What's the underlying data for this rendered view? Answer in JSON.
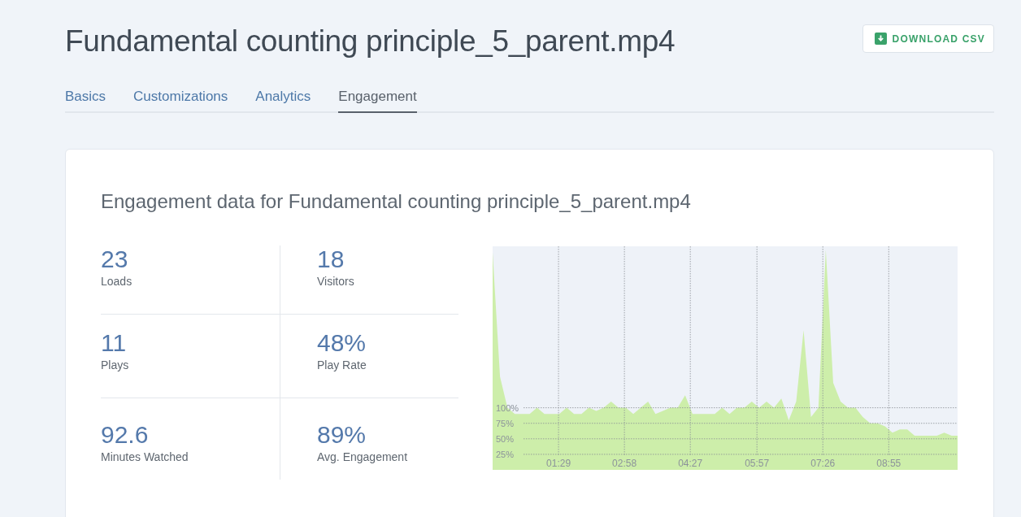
{
  "page": {
    "title": "Fundamental counting principle_5_parent.mp4"
  },
  "download_button": {
    "label": "DOWNLOAD CSV"
  },
  "tabs": [
    {
      "label": "Basics",
      "selected": false
    },
    {
      "label": "Customizations",
      "selected": false
    },
    {
      "label": "Analytics",
      "selected": false
    },
    {
      "label": "Engagement",
      "selected": true
    }
  ],
  "card": {
    "title": "Engagement data for Fundamental counting principle_5_parent.mp4",
    "stats": [
      {
        "value": "23",
        "label": "Loads"
      },
      {
        "value": "18",
        "label": "Visitors"
      },
      {
        "value": "11",
        "label": "Plays"
      },
      {
        "value": "48%",
        "label": "Play Rate"
      },
      {
        "value": "92.6",
        "label": "Minutes Watched"
      },
      {
        "value": "89%",
        "label": "Avg. Engagement"
      }
    ],
    "chart_data": {
      "type": "area",
      "x": [
        0,
        10,
        20,
        30,
        40,
        50,
        60,
        70,
        80,
        90,
        100,
        110,
        120,
        130,
        140,
        150,
        160,
        170,
        180,
        190,
        200,
        210,
        220,
        230,
        240,
        250,
        260,
        270,
        280,
        290,
        300,
        310,
        320,
        330,
        340,
        350,
        360,
        370,
        380,
        390,
        400,
        410,
        420,
        430,
        440,
        450,
        460,
        470,
        480,
        490,
        500,
        510,
        520,
        530,
        540,
        550,
        560,
        570,
        580,
        590,
        600,
        610,
        620,
        628
      ],
      "grid": true,
      "series": [
        {
          "color": "#cdeeaa",
          "values": [
            350,
            150,
            100,
            90,
            90,
            90,
            100,
            90,
            90,
            90,
            100,
            90,
            90,
            100,
            95,
            100,
            110,
            100,
            100,
            90,
            100,
            110,
            90,
            95,
            100,
            100,
            120,
            90,
            90,
            90,
            90,
            100,
            90,
            100,
            100,
            110,
            100,
            110,
            100,
            115,
            80,
            110,
            225,
            85,
            100,
            354,
            140,
            110,
            100,
            100,
            85,
            75,
            75,
            70,
            60,
            65,
            65,
            55,
            55,
            55,
            55,
            60,
            55,
            55
          ]
        }
      ],
      "xlim": [
        0,
        628
      ],
      "ylim": [
        0,
        360
      ],
      "xticks": [
        {
          "value": 89,
          "label": "01:29"
        },
        {
          "value": 178,
          "label": "02:58"
        },
        {
          "value": 267,
          "label": "04:27"
        },
        {
          "value": 357,
          "label": "05:57"
        },
        {
          "value": 446,
          "label": "07:26"
        },
        {
          "value": 535,
          "label": "08:55"
        }
      ],
      "yticks": [
        {
          "value": 25,
          "label": "25%"
        },
        {
          "value": 50,
          "label": "50%"
        },
        {
          "value": 75,
          "label": "75%"
        },
        {
          "value": 100,
          "label": "100%"
        }
      ]
    }
  }
}
